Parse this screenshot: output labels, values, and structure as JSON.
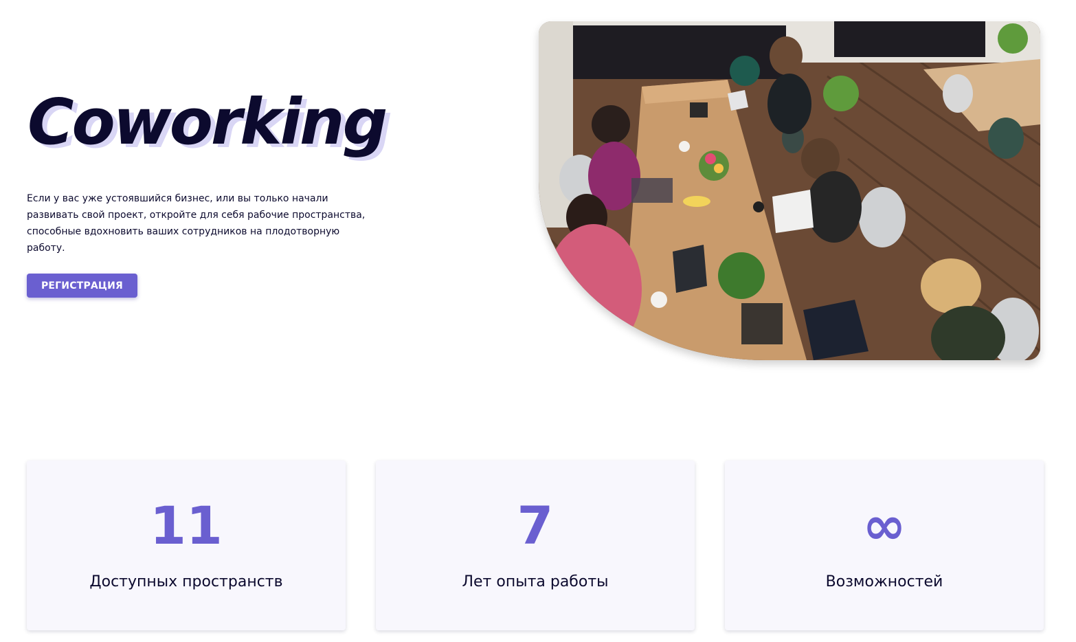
{
  "hero": {
    "title": "Coworking",
    "description": "Если у вас уже устоявшийся бизнес, или вы только начали развивать свой проект, откройте для себя рабочие пространства, способные вдохновить ваших сотрудников на плодотворную работу.",
    "cta_label": "РЕГИСТРАЦИЯ",
    "photo_icon": "coworking-photo"
  },
  "stats": [
    {
      "value": "11",
      "label": "Доступных пространств"
    },
    {
      "value": "7",
      "label": "Лет опыта работы"
    },
    {
      "value": "∞",
      "label": "Возможностей"
    }
  ],
  "colors": {
    "accent": "#6a5fd0",
    "text": "#0c0a2e",
    "card_bg": "#f8f7fd",
    "title_shadow": "#d9d6f5"
  }
}
